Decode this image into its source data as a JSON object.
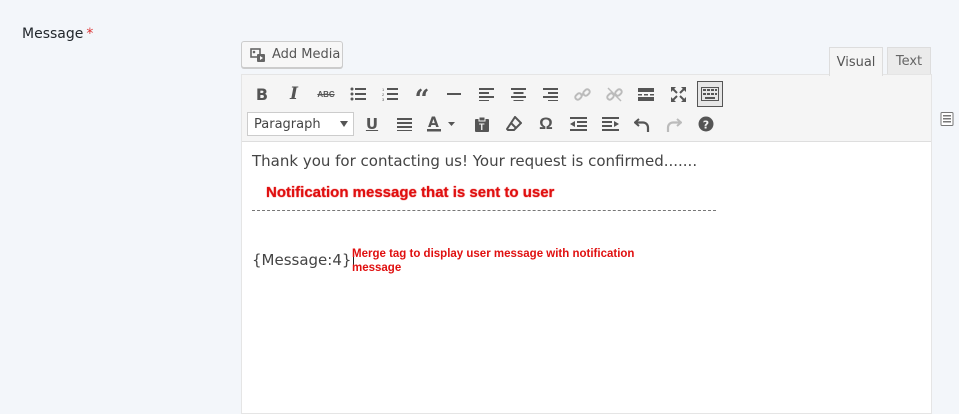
{
  "field": {
    "label": "Message",
    "required_mark": "*"
  },
  "media": {
    "add_media_label": "Add Media"
  },
  "tabs": {
    "visual": "Visual",
    "text": "Text"
  },
  "toolbar": {
    "format_select_value": "Paragraph",
    "row1_icons": [
      "bold-icon",
      "italic-icon",
      "strikethrough-icon",
      "bullet-list-icon",
      "numbered-list-icon",
      "blockquote-icon",
      "horizontal-rule-icon",
      "align-left-icon",
      "align-center-icon",
      "align-right-icon",
      "insert-link-icon",
      "remove-link-icon",
      "read-more-icon",
      "fullscreen-icon",
      "toolbar-toggle-icon"
    ],
    "row2_icons": [
      "underline-icon",
      "justify-icon",
      "text-color-icon",
      "paste-as-text-icon",
      "clear-formatting-icon",
      "special-character-icon",
      "outdent-icon",
      "indent-icon",
      "undo-icon",
      "redo-icon",
      "help-icon"
    ]
  },
  "content": {
    "line1": "Thank you for contacting us! Your request is confirmed.......",
    "annotation_main": "Notification message that is sent to user",
    "merge_tag": "{Message:4}",
    "annotation_small": "Merge tag to display user message with notification message"
  },
  "colors": {
    "annotation": "#e01010",
    "background": "#f3f6fa"
  }
}
